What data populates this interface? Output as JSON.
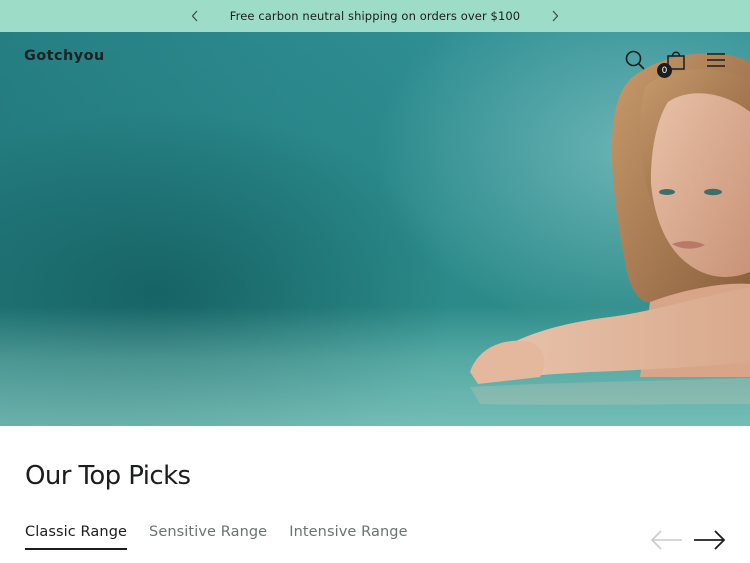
{
  "announcement": {
    "text": "Free carbon neutral shipping on orders over $100",
    "prev_icon": "chevron-left-icon",
    "next_icon": "chevron-right-icon"
  },
  "header": {
    "logo": "Gotchyou",
    "icons": [
      "search-icon",
      "shopping-bag-icon",
      "hamburger-menu-icon"
    ],
    "cart_count": "0"
  },
  "hero": {
    "image": "woman-in-teal-water-photo"
  },
  "top_picks": {
    "title": "Our Top Picks",
    "tabs": [
      {
        "label": "Classic Range",
        "active": true
      },
      {
        "label": "Sensitive Range",
        "active": false
      },
      {
        "label": "Intensive Range",
        "active": false
      }
    ],
    "prev_icon": "arrow-left-icon",
    "next_icon": "arrow-right-icon"
  },
  "colors": {
    "announcement_bg": "#9ddcc7",
    "hero_teal": "#2c8b89",
    "text": "#1c1d1d",
    "muted_tab": "#6b7472"
  }
}
